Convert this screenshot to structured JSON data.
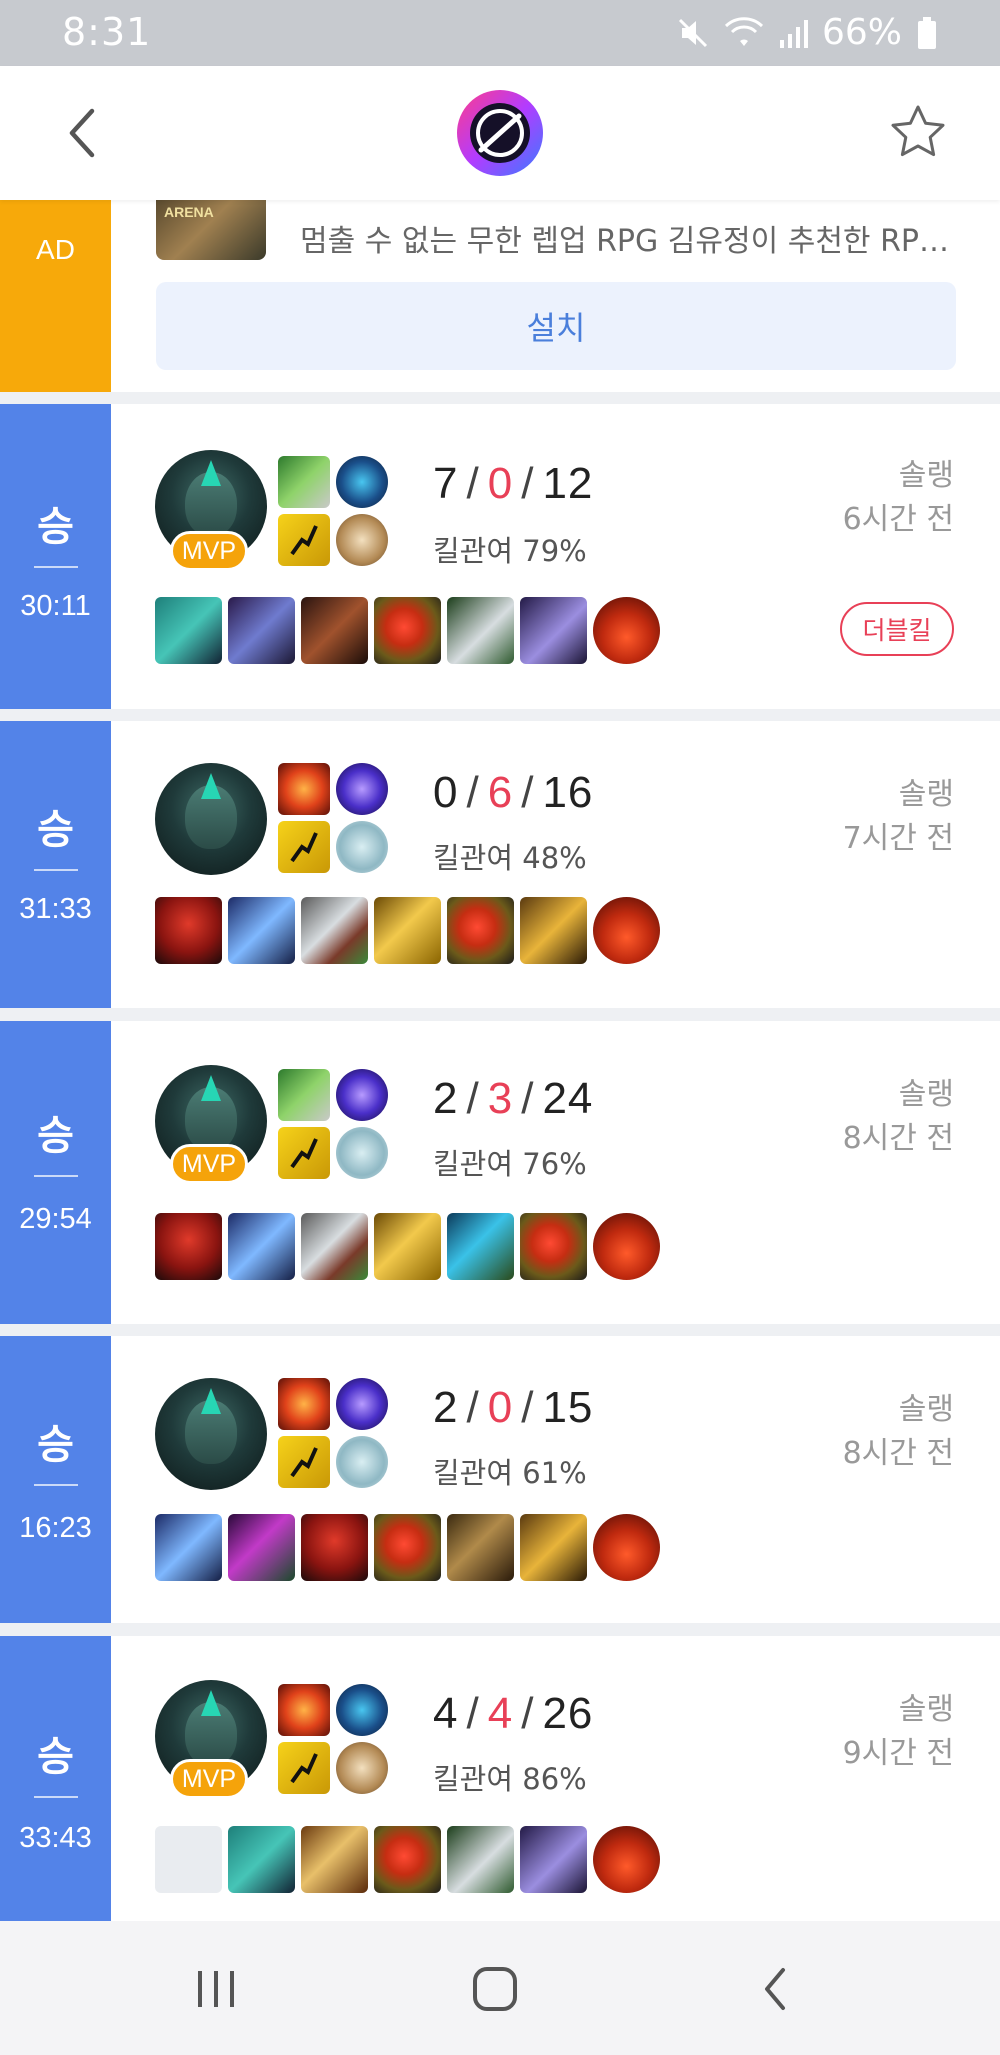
{
  "status_bar": {
    "time": "8:31",
    "battery_text": "66%",
    "icons": [
      "mute-icon",
      "wifi-icon",
      "signal-icon",
      "battery-icon"
    ]
  },
  "header": {
    "back_icon": "chevron-left-icon",
    "logo": "app-logo",
    "favorite_icon": "star-outline-icon"
  },
  "ad": {
    "label": "AD",
    "thumbnail_text": "ARENA",
    "description": "멈출 수 없는 무한 렙업 RPG 김유정이 추천한 RPG...",
    "install_label": "설치"
  },
  "matches": [
    {
      "result": "승",
      "duration": "30:11",
      "mvp": true,
      "mvp_label": "MVP",
      "kda": {
        "kills": "7",
        "deaths": "0",
        "assists": "12"
      },
      "kill_participation": "킬관여 79%",
      "queue": "솔랭",
      "time_ago": "6시간 전",
      "multikill": "더블킬"
    },
    {
      "result": "승",
      "duration": "31:33",
      "mvp": false,
      "mvp_label": "",
      "kda": {
        "kills": "0",
        "deaths": "6",
        "assists": "16"
      },
      "kill_participation": "킬관여 48%",
      "queue": "솔랭",
      "time_ago": "7시간 전",
      "multikill": ""
    },
    {
      "result": "승",
      "duration": "29:54",
      "mvp": true,
      "mvp_label": "MVP",
      "kda": {
        "kills": "2",
        "deaths": "3",
        "assists": "24"
      },
      "kill_participation": "킬관여 76%",
      "queue": "솔랭",
      "time_ago": "8시간 전",
      "multikill": ""
    },
    {
      "result": "승",
      "duration": "16:23",
      "mvp": false,
      "mvp_label": "",
      "kda": {
        "kills": "2",
        "deaths": "0",
        "assists": "15"
      },
      "kill_participation": "킬관여 61%",
      "queue": "솔랭",
      "time_ago": "8시간 전",
      "multikill": ""
    },
    {
      "result": "승",
      "duration": "33:43",
      "mvp": true,
      "mvp_label": "MVP",
      "kda": {
        "kills": "4",
        "deaths": "4",
        "assists": "26"
      },
      "kill_participation": "킬관여 86%",
      "queue": "솔랭",
      "time_ago": "9시간 전",
      "multikill": ""
    }
  ],
  "colors": {
    "win": "#5383e8",
    "ad": "#f7a90a",
    "death": "#e84057",
    "mvp": "#f5a30a"
  },
  "nav_bar": {
    "icons": [
      "recent-apps-icon",
      "home-icon",
      "back-icon"
    ]
  }
}
